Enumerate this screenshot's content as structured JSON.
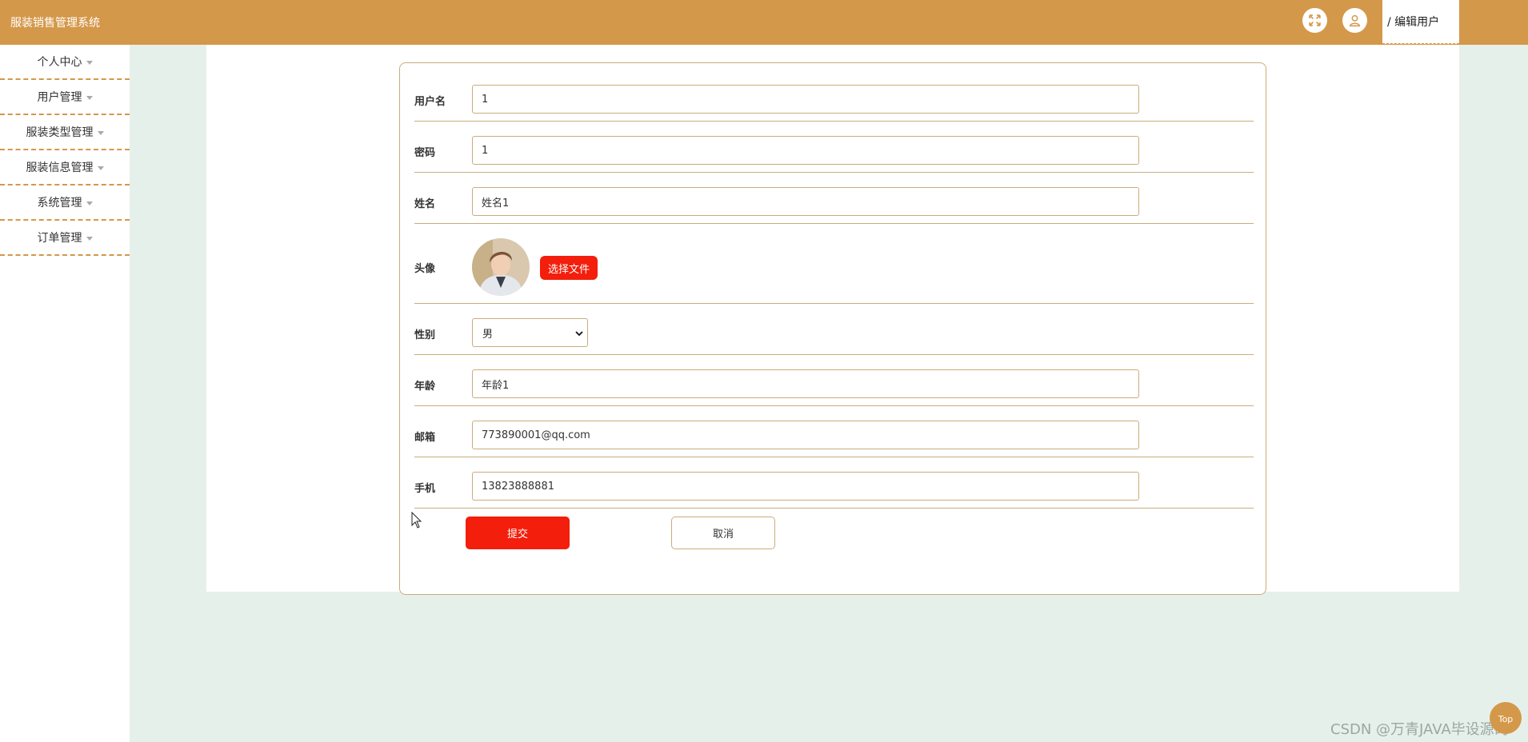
{
  "header": {
    "app_title": "服装销售管理系统",
    "breadcrumb": "/ 编辑用户",
    "icons": [
      "fullscreen-icon",
      "user-icon"
    ]
  },
  "sidebar": {
    "items": [
      {
        "label": "个人中心"
      },
      {
        "label": "用户管理"
      },
      {
        "label": "服装类型管理"
      },
      {
        "label": "服装信息管理"
      },
      {
        "label": "系统管理"
      },
      {
        "label": "订单管理"
      }
    ]
  },
  "form": {
    "username": {
      "label": "用户名",
      "value": "1"
    },
    "password": {
      "label": "密码",
      "value": "1"
    },
    "name": {
      "label": "姓名",
      "value": "姓名1"
    },
    "avatar": {
      "label": "头像",
      "button": "选择文件"
    },
    "gender": {
      "label": "性别",
      "value": "男"
    },
    "age": {
      "label": "年龄",
      "value": "年龄1"
    },
    "email": {
      "label": "邮箱",
      "value": "773890001@qq.com"
    },
    "phone": {
      "label": "手机",
      "value": "13823888881"
    },
    "submit_label": "提交",
    "cancel_label": "取消"
  },
  "footer": {
    "watermark": "CSDN @万青JAVA毕设源码",
    "top_label": "Top"
  },
  "colors": {
    "header": "#d4984a",
    "accent_red": "#f31e0b",
    "border": "#c9ad7d",
    "background": "#e6f0ea"
  }
}
